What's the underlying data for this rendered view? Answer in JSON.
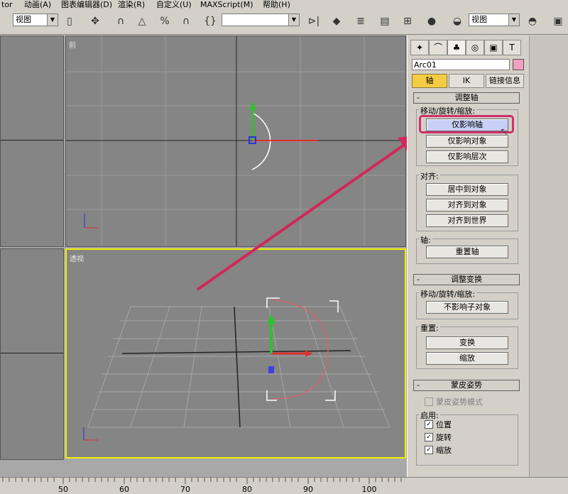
{
  "menu": [
    "tor",
    "动画(A)",
    "图表编辑器(D)",
    "渲染(R)",
    "自定义(U)",
    "MAXScript(M)",
    "帮助(H)"
  ],
  "toolbar": {
    "view_combo_left": "视图",
    "view_combo_right": "视图"
  },
  "viewports": {
    "front_label": "前",
    "persp_label": "透视"
  },
  "panel": {
    "object_name": "Arc01",
    "object_color": "#f2a0c0",
    "tabs": [
      "轴",
      "IK",
      "链接信息"
    ],
    "adjust_pivot": {
      "title": "调整轴",
      "move_group": "移动/旋转/缩放:",
      "btn_pivot_only": "仅影响轴",
      "btn_object_only": "仅影响对象",
      "btn_hierarchy_only": "仅影响层次",
      "align_group": "对齐:",
      "btn_center": "居中到对象",
      "btn_align_obj": "对齐到对象",
      "btn_align_world": "对齐到世界",
      "axis_group": "轴:",
      "btn_reset": "重置轴"
    },
    "adjust_transform": {
      "title": "调整变换",
      "move_group": "移动/旋转/缩放:",
      "btn_dont_affect": "不影响子对象",
      "reset_group": "重置:",
      "btn_transform": "变换",
      "btn_scale": "缩放"
    },
    "skin_pose": {
      "title": "蒙皮姿势",
      "mode": "蒙皮姿势模式",
      "enable_group": "启用:",
      "chk_position": "位置",
      "chk_rotation": "旋转",
      "chk_scale": "缩放"
    }
  },
  "ruler": {
    "labels": [
      "50",
      "60",
      "70",
      "80",
      "90",
      "100"
    ]
  },
  "colors": {
    "highlight_border": "#d03068",
    "arrow": "#d0285a",
    "active_viewport": "#f0f000",
    "arc": "#ffffff",
    "gizmo_x": "#e03030",
    "gizmo_y": "#30c030",
    "gizmo_z": "#3030e0"
  }
}
